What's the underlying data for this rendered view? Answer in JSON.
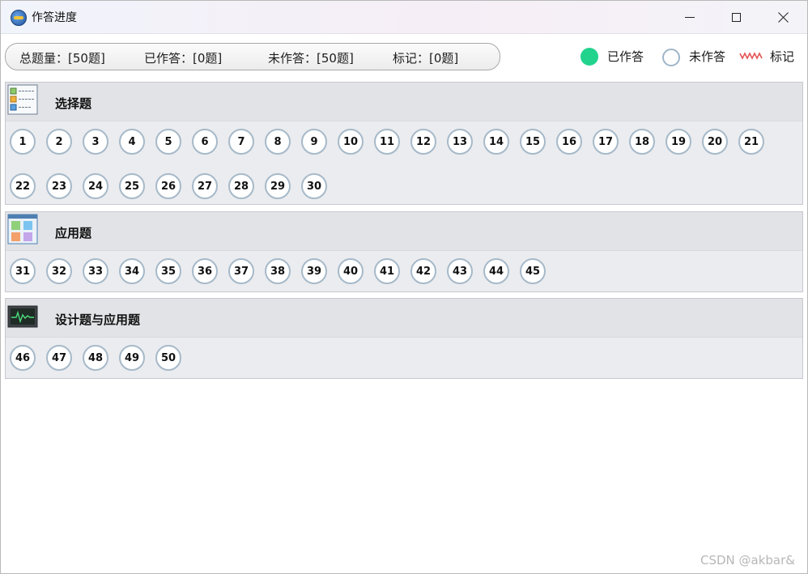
{
  "window": {
    "title": "作答进度",
    "controls": {
      "minimize_icon": "minimize-icon",
      "maximize_icon": "maximize-icon",
      "close_icon": "close-icon"
    }
  },
  "summary": {
    "total": "总题量：[50题]",
    "answered": "已作答：[0题]",
    "unanswered": "未作答：[50题]",
    "marked": "标记：[0题]"
  },
  "legend": {
    "answered_label": "已作答",
    "unanswered_label": "未作答",
    "marked_label": "标记",
    "answered_color": "#22d38e",
    "unanswered_border": "#9fb5c8",
    "marked_color": "#e55353"
  },
  "sections": [
    {
      "title": "选择题",
      "icon": "checklist-icon",
      "questions": [
        "1",
        "2",
        "3",
        "4",
        "5",
        "6",
        "7",
        "8",
        "9",
        "10",
        "11",
        "12",
        "13",
        "14",
        "15",
        "16",
        "17",
        "18",
        "19",
        "20",
        "21",
        "22",
        "23",
        "24",
        "25",
        "26",
        "27",
        "28",
        "29",
        "30"
      ]
    },
    {
      "title": "应用题",
      "icon": "app-grid-icon",
      "questions": [
        "31",
        "32",
        "33",
        "34",
        "35",
        "36",
        "37",
        "38",
        "39",
        "40",
        "41",
        "42",
        "43",
        "44",
        "45"
      ]
    },
    {
      "title": "设计题与应用题",
      "icon": "monitor-chart-icon",
      "questions": [
        "46",
        "47",
        "48",
        "49",
        "50"
      ]
    }
  ],
  "watermark": "CSDN @akbar&"
}
